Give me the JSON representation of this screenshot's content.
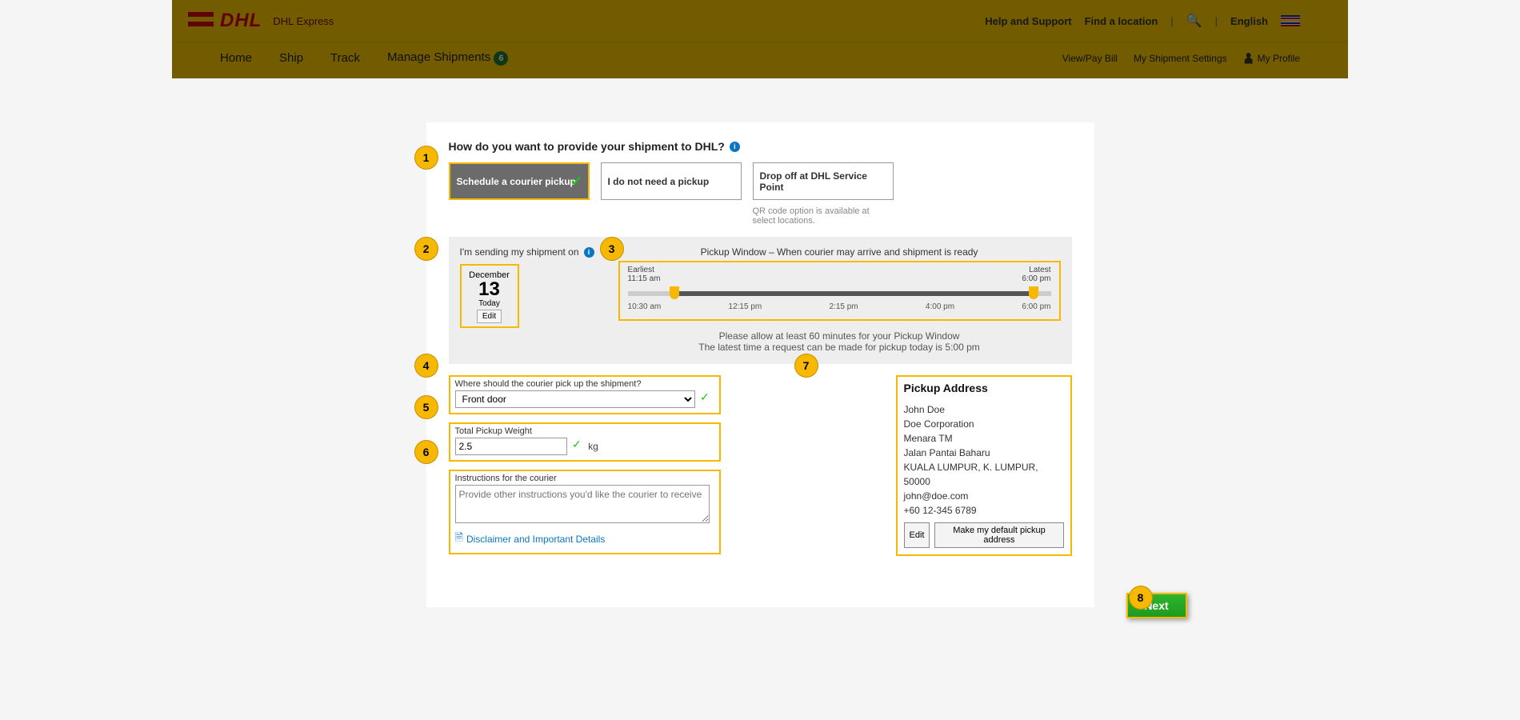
{
  "header": {
    "logo_sub": "DHL Express",
    "help": "Help and Support",
    "find": "Find a location",
    "lang": "English"
  },
  "nav": {
    "home": "Home",
    "ship": "Ship",
    "track": "Track",
    "manage": "Manage Shipments",
    "manage_badge": "6",
    "viewpay": "View/Pay Bill",
    "settings": "My Shipment Settings",
    "profile": "My Profile"
  },
  "modal": {
    "title": "How do you want to provide your shipment to DHL?",
    "options": {
      "schedule": "Schedule a courier pickup",
      "noneed": "I do not need a pickup",
      "dropoff": "Drop off at DHL Service Point"
    },
    "qr_note": "QR code option is available at select locations.",
    "date_label": "I'm sending my shipment on",
    "date_month": "December",
    "date_day": "13",
    "date_today": "Today",
    "edit": "Edit",
    "window_title": "Pickup Window – When courier may arrive and shipment is ready",
    "earliest_l": "Earliest",
    "earliest_v": "11:15 am",
    "latest_l": "Latest",
    "latest_v": "6:00 pm",
    "ticks": [
      "10:30 am",
      "12:15 pm",
      "2:15 pm",
      "4:00 pm",
      "6:00 pm"
    ],
    "allow1": "Please allow at least 60 minutes for your Pickup Window",
    "allow2": "The latest time a request can be made for pickup today is 5:00 pm",
    "loc_label": "Where should the courier pick up the shipment?",
    "loc_value": "Front door",
    "weight_label": "Total Pickup Weight",
    "weight_value": "2.5",
    "weight_unit": "kg",
    "instr_label": "Instructions for the courier",
    "instr_placeholder": "Provide other instructions you'd like the courier to receive",
    "disclaimer": "Disclaimer and Important Details",
    "addr_title": "Pickup Address",
    "addr": {
      "name": "John Doe",
      "company": "Doe Corporation",
      "bldg": "Menara TM",
      "street": "Jalan Pantai Baharu",
      "citystate": "KUALA LUMPUR, K. LUMPUR, 50000",
      "email": "john@doe.com",
      "phone": "+60 12-345 6789"
    },
    "addr_edit": "Edit",
    "addr_default": "Make my default pickup address",
    "next": "Next"
  },
  "callouts": [
    "1",
    "2",
    "3",
    "4",
    "5",
    "6",
    "7",
    "8"
  ]
}
